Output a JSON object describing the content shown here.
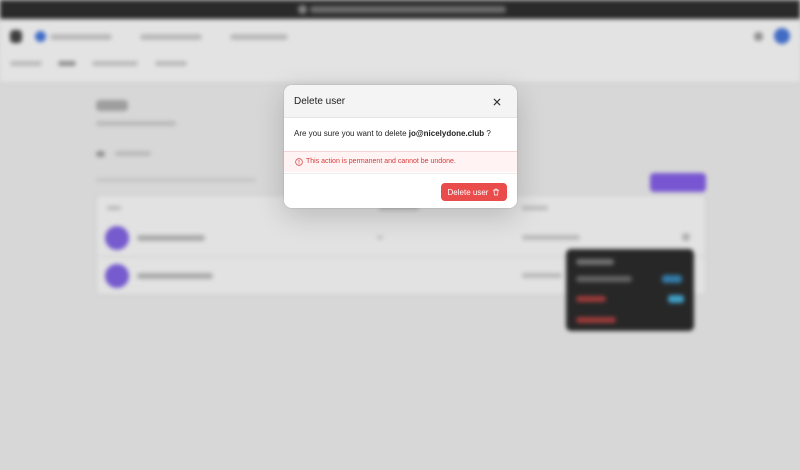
{
  "modal": {
    "title": "Delete user",
    "confirm_prefix": "Are you sure you want to delete",
    "user_email": "jo@nicelydone.club",
    "confirm_suffix": "?",
    "warning": "This action is permanent and cannot be undone.",
    "delete_label": "Delete user"
  },
  "icons": {
    "close": "close-icon",
    "warning": "alert-circle-icon",
    "delete": "trash-icon"
  },
  "colors": {
    "danger": "#ea4b4b",
    "danger_text": "#d83a3a",
    "accent": "#7d56e6"
  }
}
